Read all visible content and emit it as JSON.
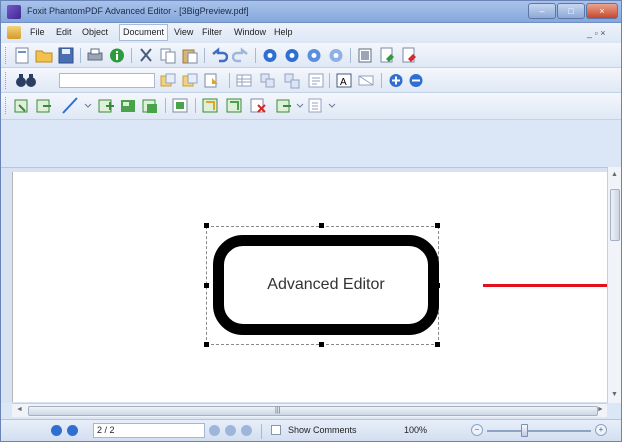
{
  "window": {
    "title": "Foxit PhantomPDF Advanced Editor - [3BigPreview.pdf]",
    "controls": {
      "minimize": "–",
      "maximize": "□",
      "close": "×"
    }
  },
  "menubar": {
    "items": [
      "File",
      "Edit",
      "Object",
      "Document",
      "View",
      "Filter",
      "Window",
      "Help"
    ],
    "active": "Document",
    "mdi_controls": "_ ▫ ×"
  },
  "toolbars": {
    "row1_icons": [
      "new-document-icon",
      "open-folder-icon",
      "save-icon",
      "print-icon",
      "info-icon",
      "cut-icon",
      "copy-icon",
      "paste-icon",
      "undo-icon",
      "redo-icon",
      "circle-blue-1-icon",
      "circle-blue-2-icon",
      "circle-blue-3-icon",
      "circle-blue-4-icon",
      "page-view-icon",
      "export-icon",
      "export-red-icon"
    ],
    "row2_icons": [
      "binoculars-icon",
      "find-prev-icon",
      "find-next-icon",
      "select-tool-icon",
      "table-icon",
      "object-group-icon",
      "object-ungroup-icon",
      "align-icon",
      "text-object-icon",
      "image-object-icon",
      "zoom-in-icon",
      "zoom-out-icon"
    ],
    "row3_icons": [
      "move-object-icon",
      "resize-object-icon",
      "line-tool-icon",
      "add-image-icon",
      "add-shading-icon",
      "add-path-icon",
      "clip-icon",
      "crop-icon",
      "rotate-icon",
      "delete-object-icon",
      "properties-icon",
      "layers-icon"
    ],
    "search_value": ""
  },
  "document": {
    "shape_text": "Advanced Editor",
    "line_color": "#e3111b"
  },
  "statusbar": {
    "page_field": "2 / 2",
    "show_comments_label": "Show Comments",
    "show_comments_checked": false,
    "zoom": "100%",
    "zoom_out": "−",
    "zoom_in": "+"
  },
  "colors": {
    "titlebar": "#86a7dc",
    "menubar": "#dce6f5",
    "accent_blue": "#2f6fd1"
  }
}
